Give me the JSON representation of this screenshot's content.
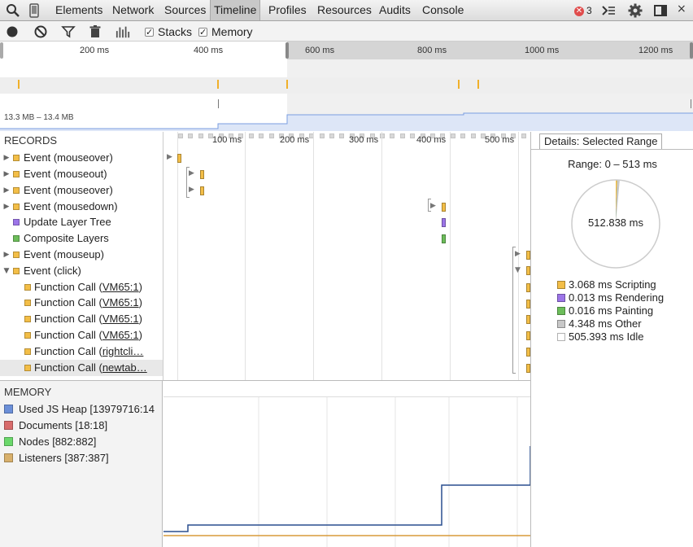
{
  "tabs": [
    {
      "label": "Elements"
    },
    {
      "label": "Network"
    },
    {
      "label": "Sources"
    },
    {
      "label": "Timeline"
    },
    {
      "label": "Profiles"
    },
    {
      "label": "Resources"
    },
    {
      "label": "Audits"
    },
    {
      "label": "Console"
    }
  ],
  "error_count": "3",
  "toolbar": {
    "stacks_label": "Stacks",
    "memory_label": "Memory"
  },
  "overview": {
    "ticks": [
      "200 ms",
      "400 ms",
      "600 ms",
      "800 ms",
      "1000 ms",
      "1200 ms"
    ],
    "memory_range": "13.3 MB – 13.4 MB"
  },
  "records": {
    "header": "RECORDS",
    "rows": [
      {
        "label": "Event (mouseover)",
        "link": "",
        "suffix": "",
        "expander": "▶"
      },
      {
        "label": "Event (mouseout)",
        "link": "",
        "suffix": "",
        "expander": "▶"
      },
      {
        "label": "Event (mouseover)",
        "link": "",
        "suffix": "",
        "expander": "▶"
      },
      {
        "label": "Event (mousedown)",
        "link": "",
        "suffix": "",
        "expander": "▶"
      },
      {
        "label": "Update Layer Tree",
        "link": "",
        "suffix": "",
        "expander": ""
      },
      {
        "label": "Composite Layers",
        "link": "",
        "suffix": "",
        "expander": ""
      },
      {
        "label": "Event (mouseup)",
        "link": "",
        "suffix": "",
        "expander": "▶"
      },
      {
        "label": "Event (click)",
        "link": "",
        "suffix": "",
        "expander": "▼"
      },
      {
        "label": "Function Call (",
        "link": "VM65:1",
        "suffix": ")",
        "expander": ""
      },
      {
        "label": "Function Call (",
        "link": "VM65:1",
        "suffix": ")",
        "expander": ""
      },
      {
        "label": "Function Call (",
        "link": "VM65:1",
        "suffix": ")",
        "expander": ""
      },
      {
        "label": "Function Call (",
        "link": "VM65:1",
        "suffix": ")",
        "expander": ""
      },
      {
        "label": "Function Call (",
        "link": "rightcli…",
        "suffix": "",
        "expander": ""
      },
      {
        "label": "Function Call (",
        "link": "newtab…",
        "suffix": "",
        "expander": ""
      }
    ]
  },
  "grid": {
    "ticks": [
      "100 ms",
      "200 ms",
      "300 ms",
      "400 ms",
      "500 ms"
    ]
  },
  "details": {
    "tab_label": "Details: Selected Range",
    "range": "Range: 0 – 513 ms",
    "total": "512.838 ms",
    "legend": [
      {
        "value": "3.068 ms Scripting",
        "color": "#f3be47",
        "ms": 3.068
      },
      {
        "value": "0.013 ms Rendering",
        "color": "#9c75e8",
        "ms": 0.013
      },
      {
        "value": "0.016 ms Painting",
        "color": "#6cbd5a",
        "ms": 0.016
      },
      {
        "value": "4.348 ms Other",
        "color": "#c8c8c8",
        "ms": 4.348
      },
      {
        "value": "505.393 ms Idle",
        "color": "#ffffff",
        "ms": 505.393
      }
    ]
  },
  "memory": {
    "header": "MEMORY",
    "counters": [
      {
        "label": "Used JS Heap [13979716:14",
        "color": "#6b8fd8"
      },
      {
        "label": "Documents [18:18]",
        "color": "#d86b6b"
      },
      {
        "label": "Nodes [882:882]",
        "color": "#6bd86b"
      },
      {
        "label": "Listeners [387:387]",
        "color": "#d8b06b"
      }
    ]
  },
  "colors": {
    "scripting": "#f3be47",
    "rendering": "#9c75e8",
    "painting": "#6cbd5a",
    "heap_line": "#2a4f8f",
    "listeners_line": "#d89a3a"
  }
}
